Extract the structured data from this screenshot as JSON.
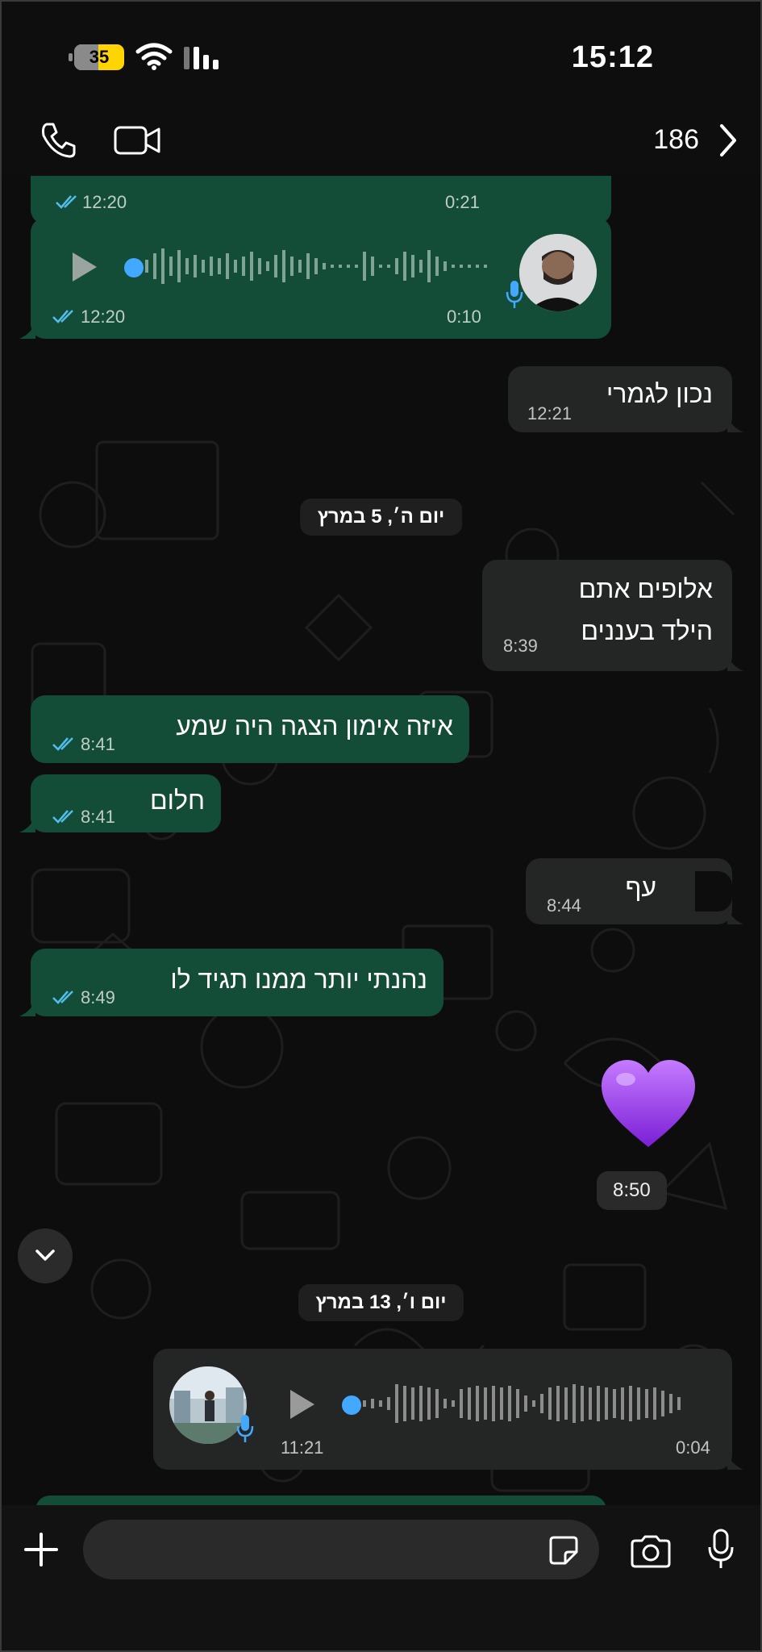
{
  "status_bar": {
    "time": "15:12",
    "battery": "35",
    "icons": [
      "wifi-icon",
      "signal-bars-icon"
    ]
  },
  "header": {
    "count": "186",
    "icons": [
      "phone-icon",
      "video-call-icon",
      "chevron-right-icon"
    ]
  },
  "messages": {
    "partial_voice": {
      "time": "12:20",
      "duration": "0:21"
    },
    "voice1": {
      "time": "12:20",
      "duration": "0:10"
    },
    "m1": {
      "text": "נכון לגמרי",
      "time": "12:21"
    },
    "date1": "יום ה׳, 5 במרץ",
    "m2": {
      "line1": "אלופים אתם",
      "line2": "הילד בעננים",
      "time": "8:39"
    },
    "m3": {
      "text": "איזה אימון הצגה היה שמע",
      "time": "8:41"
    },
    "m4": {
      "text": "חלום",
      "time": "8:41"
    },
    "m5": {
      "text": "עף",
      "time": "8:44"
    },
    "m6": {
      "text": "נהנתי יותר ממנו תגיד לו",
      "time": "8:49"
    },
    "m7": {
      "emoji": "purple-heart",
      "time": "8:50"
    },
    "date2": "יום ו׳, 13 במרץ",
    "voice2": {
      "time": "11:21",
      "duration": "0:04"
    }
  },
  "input_bar": {
    "placeholder": "",
    "icons": [
      "plus-icon",
      "sticker-icon",
      "camera-icon",
      "microphone-icon"
    ]
  },
  "colors": {
    "outgoing_bubble": "#134d37",
    "incoming_bubble": "#242626",
    "read_ticks": "#53bdeb",
    "voice_dot": "#43a8ff",
    "battery": "#ffd400",
    "heart": "#9b3df5"
  }
}
